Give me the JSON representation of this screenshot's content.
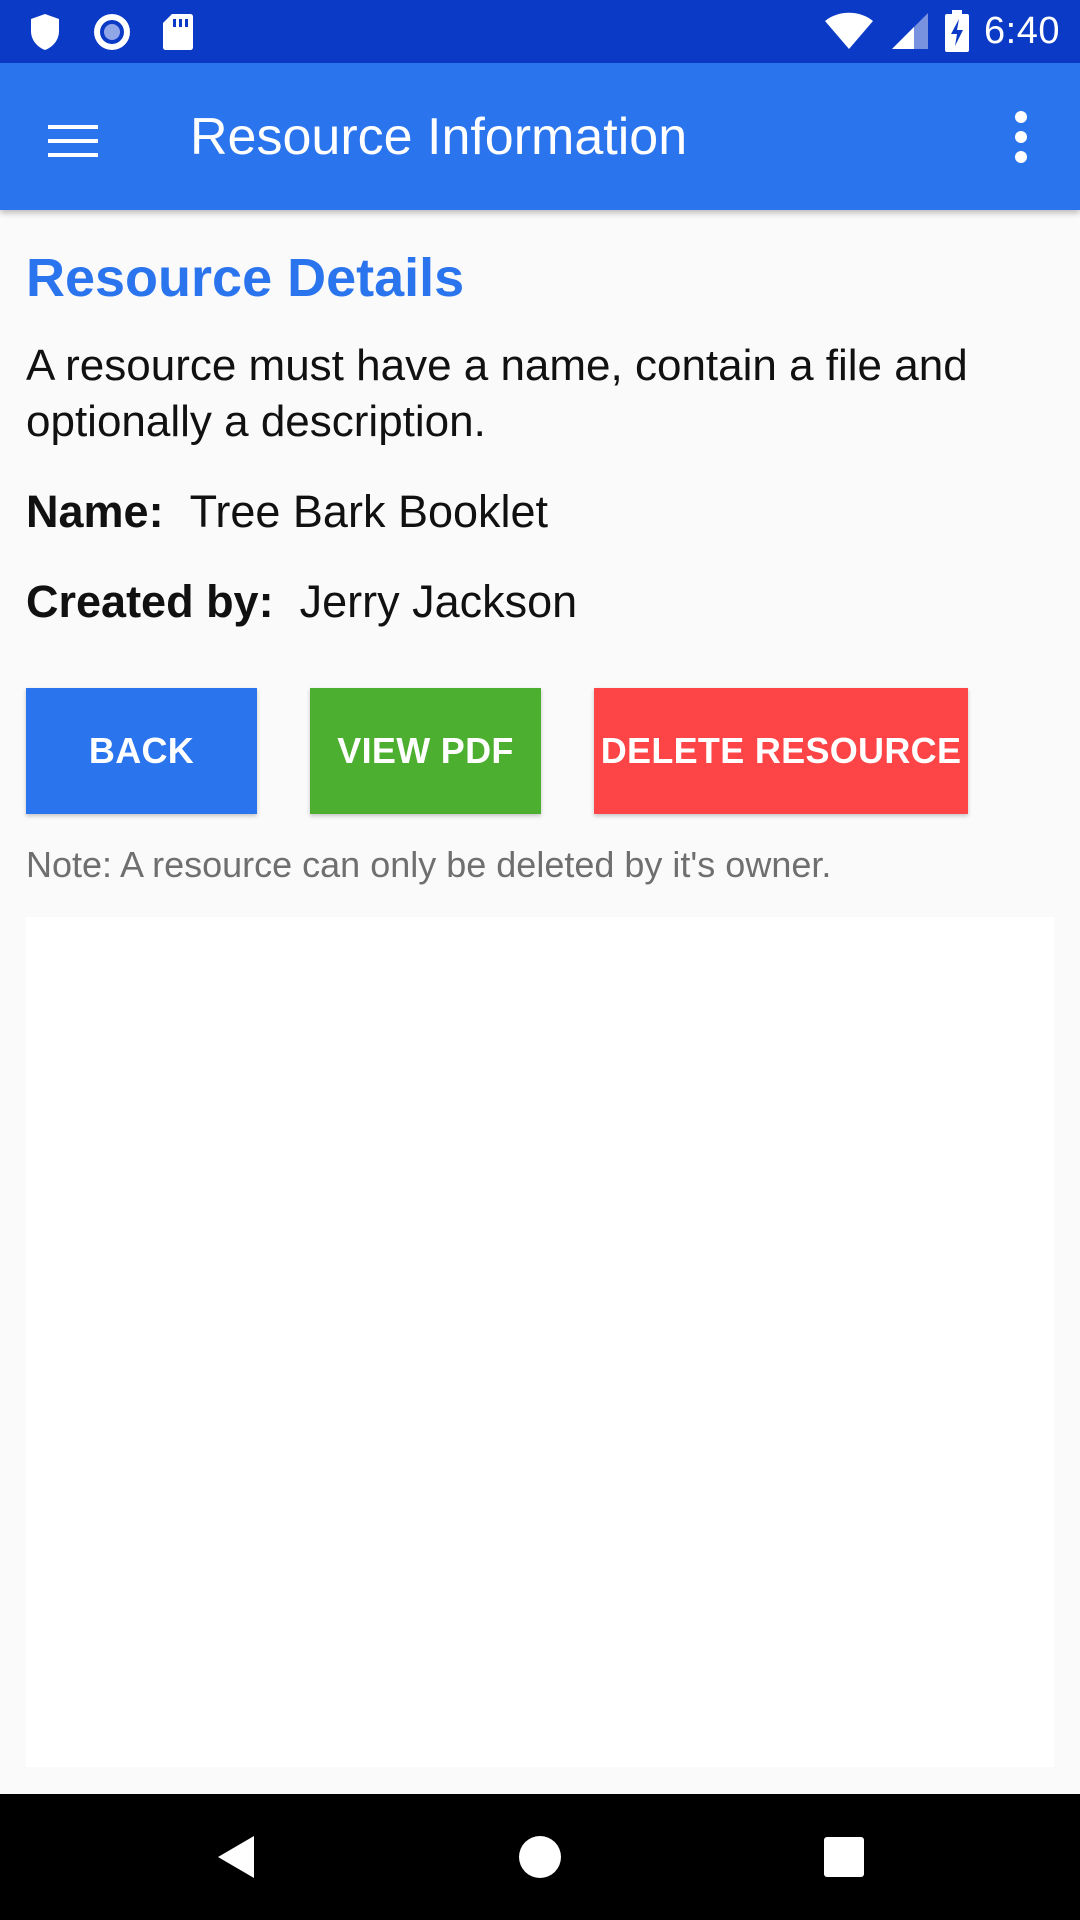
{
  "status_bar": {
    "time": "6:40",
    "icons": [
      "shield-icon",
      "record-icon",
      "sd-card-icon",
      "wifi-icon",
      "signal-icon",
      "battery-charging-icon"
    ]
  },
  "app_bar": {
    "title": "Resource Information",
    "menu_icon": "hamburger-menu-icon",
    "overflow_icon": "more-vert-icon"
  },
  "content": {
    "section_title": "Resource Details",
    "description": "A resource must have a name, contain a file and optionally a description.",
    "name_label": "Name:",
    "name_value": "Tree Bark Booklet",
    "created_label": "Created by:",
    "created_value": "Jerry Jackson",
    "note": "Note: A resource can only be deleted by it's owner."
  },
  "buttons": {
    "back": "BACK",
    "view_pdf": "VIEW PDF",
    "delete": "DELETE RESOURCE"
  },
  "colors": {
    "status_bar": "#0b3ac7",
    "app_bar": "#2a74ee",
    "accent": "#2a74ee",
    "back_button": "#2a74ee",
    "pdf_button": "#4caf2f",
    "delete_button": "#fd4447"
  },
  "nav_bar": {
    "icons": [
      "back-triangle-icon",
      "home-circle-icon",
      "recents-square-icon"
    ]
  }
}
